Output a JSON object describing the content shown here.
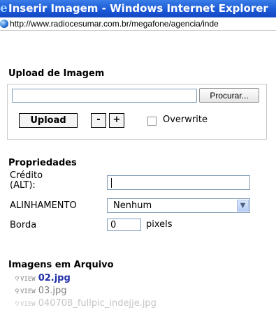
{
  "window": {
    "title": "Inserir Imagem - Windows Internet Explorer",
    "url": "http://www.radiocesumar.com.br/megafone/agencia/inde"
  },
  "upload": {
    "section_title": "Upload de Imagem",
    "browse_label": "Procurar...",
    "upload_label": "Upload",
    "minus_label": "-",
    "plus_label": "+",
    "overwrite_label": "Overwrite",
    "overwrite_checked": false
  },
  "properties": {
    "section_title": "Propriedades",
    "credit_label_line1": "Crédito",
    "credit_label_line2": "(ALT):",
    "credit_value": "",
    "align_label": "ALINHAMENTO",
    "align_value": "Nenhum",
    "border_label": "Borda",
    "border_value": "0",
    "border_unit": "pixels"
  },
  "archive": {
    "section_title": "Imagens em Arquivo",
    "view_label": "VIEW",
    "items": [
      {
        "name": "02.jpg",
        "selected": true
      },
      {
        "name": "03.jpg",
        "selected": false
      },
      {
        "name": "040708_fullpic_indejje.jpg",
        "selected": false
      }
    ]
  },
  "icons": {
    "browser": "ie-logo-icon",
    "address": "globe-page-icon",
    "view": "magnifier-icon",
    "dropdown": "chevron-down-icon"
  }
}
